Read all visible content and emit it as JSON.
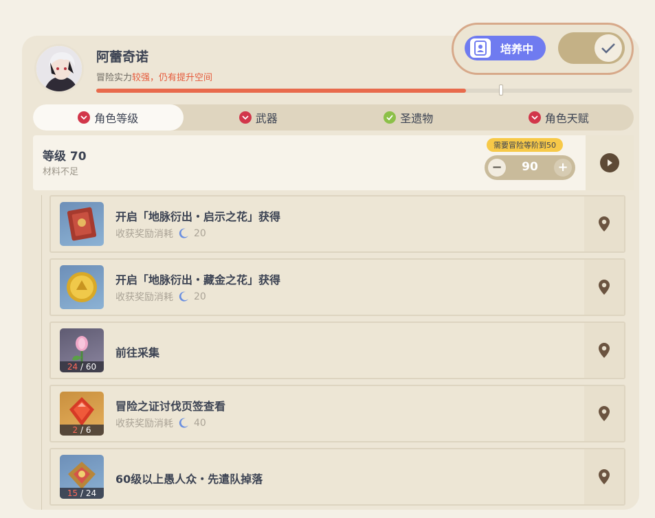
{
  "character": {
    "name": "阿蕾奇诺",
    "power_prefix": "冒险实力",
    "power_highlight": "较强，仍有提升空间",
    "progress_fraction": 0.69
  },
  "status": {
    "training_label": "培养中",
    "toggle_on": true
  },
  "tabs": [
    {
      "label": "角色等级",
      "status": "red",
      "active": true
    },
    {
      "label": "武器",
      "status": "red",
      "active": false
    },
    {
      "label": "圣遗物",
      "status": "green",
      "active": false
    },
    {
      "label": "角色天赋",
      "status": "red",
      "active": false
    }
  ],
  "level": {
    "title": "等级 70",
    "subtitle": "材料不足",
    "requirement": "需要冒险等阶到50",
    "target_value": "90",
    "minus_label": "−",
    "plus_label": "+"
  },
  "items": [
    {
      "title": "开启「地脉衍出・启示之花」获得",
      "cost_label": "收获奖励消耗",
      "cost_value": "20",
      "thumb": "book",
      "count": null
    },
    {
      "title": "开启「地脉衍出・藏金之花」获得",
      "cost_label": "收获奖励消耗",
      "cost_value": "20",
      "thumb": "coin",
      "count": null
    },
    {
      "title": "前往采集",
      "cost_label": null,
      "cost_value": null,
      "thumb": "flower",
      "count": {
        "have": "24",
        "need": "60"
      }
    },
    {
      "title": "冒险之证讨伐页签查看",
      "cost_label": "收获奖励消耗",
      "cost_value": "40",
      "thumb": "gem",
      "count": {
        "have": "2",
        "need": "6"
      }
    },
    {
      "title": "60级以上愚人众・先遣队掉落",
      "cost_label": null,
      "cost_value": null,
      "thumb": "badge",
      "count": {
        "have": "15",
        "need": "24"
      }
    }
  ],
  "colors": {
    "accent_red": "#e86a4c",
    "training_purple": "#6f7bf0",
    "badge_yellow": "#f7c948",
    "panel_bg": "#ede6d6"
  },
  "icons": [
    "avatar",
    "user-card-icon",
    "check-icon",
    "chevron-right-icon",
    "location-pin-icon",
    "moon-resin-icon"
  ]
}
